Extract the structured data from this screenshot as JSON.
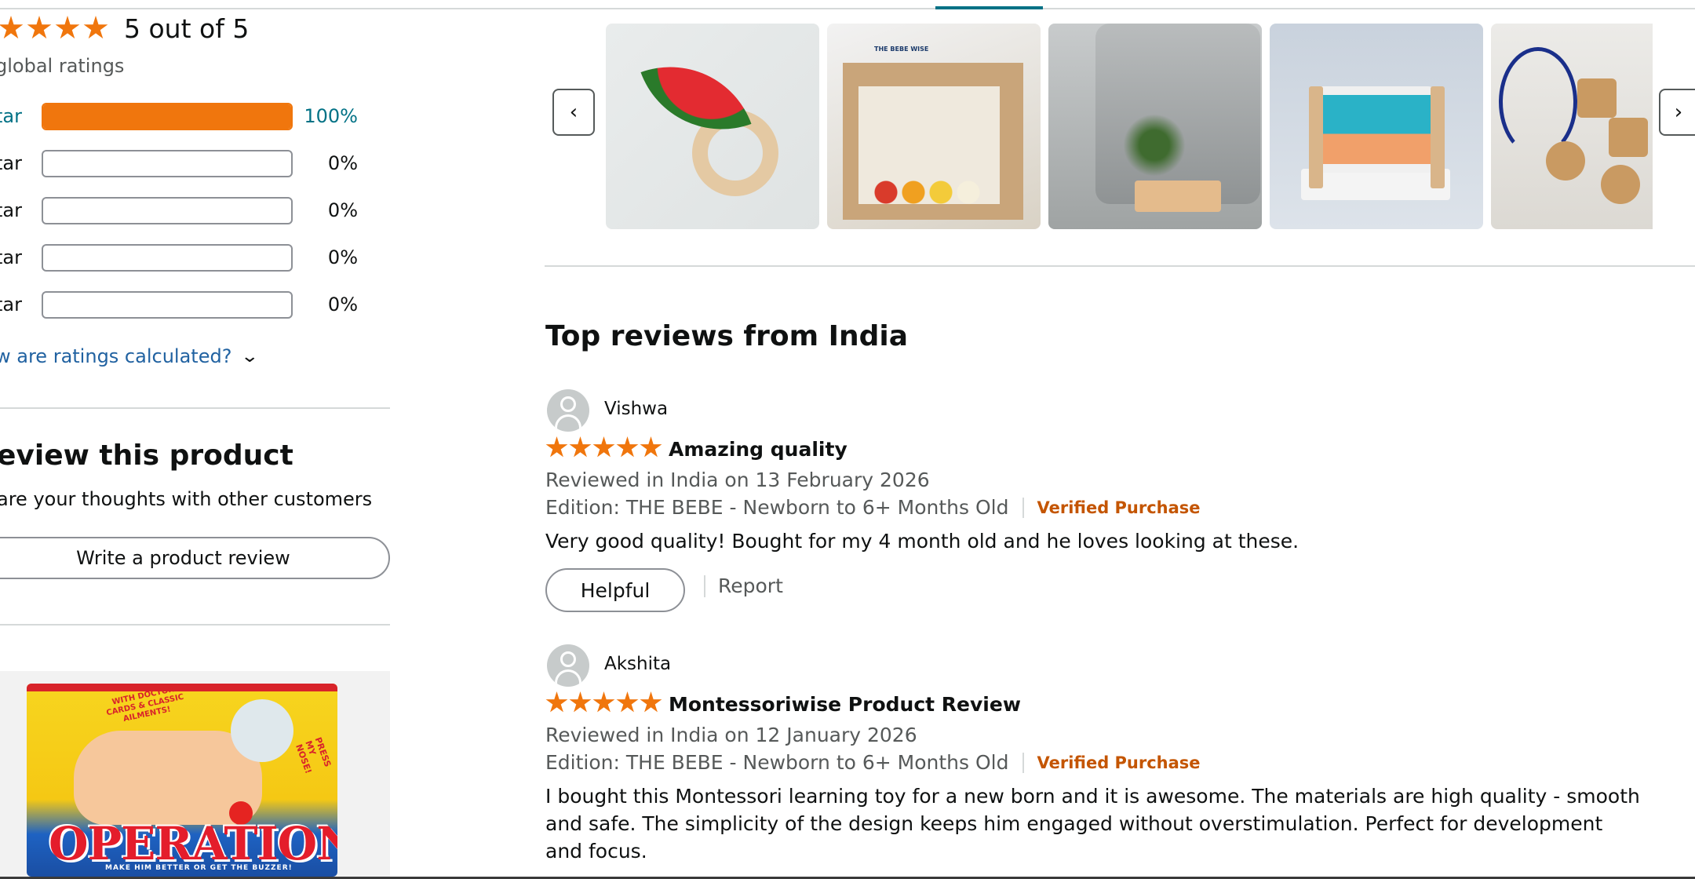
{
  "summary": {
    "rating_text": "5 out of 5",
    "global_ratings": "global ratings",
    "histogram": [
      {
        "label": "tar",
        "percent_text": "100%",
        "fill": 1.0
      },
      {
        "label": "tar",
        "percent_text": "0%",
        "fill": 0.0
      },
      {
        "label": "tar",
        "percent_text": "0%",
        "fill": 0.0
      },
      {
        "label": "tar",
        "percent_text": "0%",
        "fill": 0.0
      },
      {
        "label": "tar",
        "percent_text": "0%",
        "fill": 0.0
      }
    ],
    "how_calculated": "w are ratings calculated?"
  },
  "review_product": {
    "heading": "eview this product",
    "subtext": "are your thoughts with other customers",
    "button_label": "Write a product review"
  },
  "ad": {
    "logo": "OPERATION",
    "tag": "WITH DOCTOR CARDS & CLASSIC AILMENTS!",
    "side": "PRESS MY NOSE!",
    "sub": "MAKE HIM BETTER OR GET THE BUZZER!"
  },
  "carousel": {
    "prev_icon": "chevron-left-icon",
    "next_icon": "chevron-right-icon",
    "box_label": "THE BEBE WISE"
  },
  "reviews_section": {
    "heading": "Top reviews from India",
    "reviews": [
      {
        "reviewer": "Vishwa",
        "rating": 5,
        "title": "Amazing quality",
        "date": "Reviewed in India on 13 February 2026",
        "edition": "Edition: THE BEBE - Newborn to 6+ Months Old",
        "verified": "Verified Purchase",
        "body": "Very good quality! Bought for my 4 month old and he loves looking at these.",
        "helpful_label": "Helpful",
        "report_label": "Report"
      },
      {
        "reviewer": "Akshita",
        "rating": 5,
        "title": "Montessoriwise Product Review",
        "date": "Reviewed in India on 12 January 2026",
        "edition": "Edition: THE BEBE - Newborn to 6+ Months Old",
        "verified": "Verified Purchase",
        "body": "I bought this Montessori learning toy for a new born and it is awesome. The materials are high quality - smooth and safe. The simplicity of the design keeps him engaged without overstimulation. Perfect for development and focus."
      }
    ]
  },
  "colors": {
    "star": "#f0760d",
    "link": "#2162a1",
    "verified": "#c45500"
  }
}
